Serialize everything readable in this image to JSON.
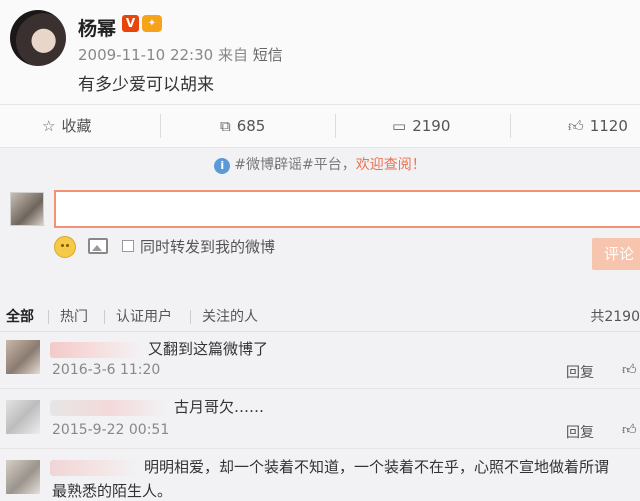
{
  "post": {
    "username": "杨幂",
    "verified_badge": "V",
    "member_badge": "会员",
    "timestamp": "2009-11-10 22:30",
    "source_prefix": "来自",
    "source": "短信",
    "text": "有多少爱可以胡来"
  },
  "actions": {
    "favorite_label": "收藏",
    "repost_count": "685",
    "comment_count": "2190",
    "like_count": "1120"
  },
  "tip": {
    "topic": "#微博辟谣#平台，",
    "link": "欢迎查阅！"
  },
  "composer": {
    "repost_label": "同时转发到我的微博",
    "submit_label": "评论"
  },
  "filters": {
    "tabs": [
      "全部",
      "热门",
      "认证用户",
      "关注的人"
    ],
    "total": "共2190"
  },
  "comments": [
    {
      "text": "又翻到这篇微博了",
      "time": "2016-3-6 11:20",
      "reply": "回复"
    },
    {
      "text": "古月哥欠……",
      "time": "2015-9-22 00:51",
      "reply": "回复"
    },
    {
      "text": "明明相爱，却一个装着不知道，一个装着不在乎，心照不宣地做着所谓",
      "text2": "最熟悉的陌生人。",
      "time": "",
      "reply": ""
    }
  ],
  "colors": {
    "accent": "#eb7350",
    "verified": "#e8450a",
    "member": "#f7a21b"
  }
}
